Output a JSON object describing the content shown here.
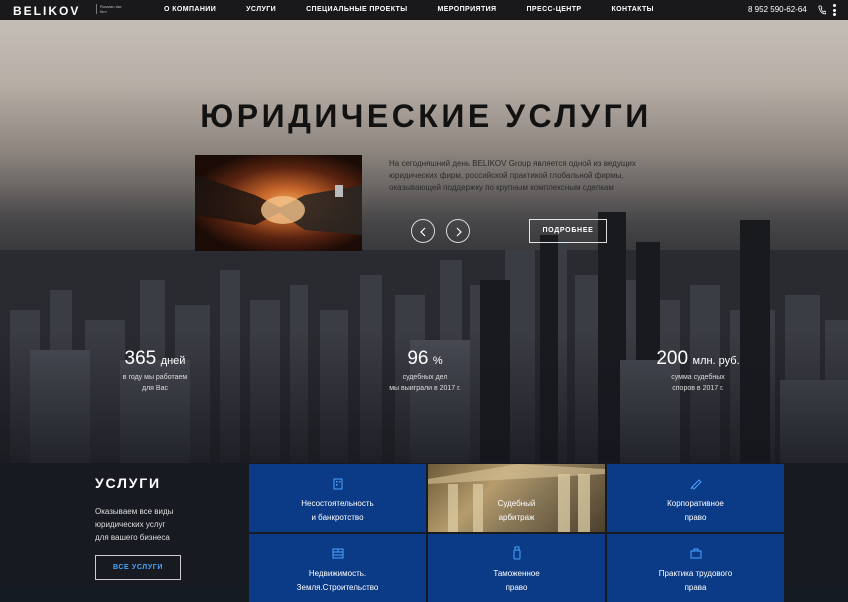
{
  "header": {
    "logo": "BELIKOV",
    "logo_sub": "Russian law firm",
    "nav": [
      "О КОМПАНИИ",
      "УСЛУГИ",
      "СПЕЦИАЛЬНЫЕ ПРОЕКТЫ",
      "МЕРОПРИЯТИЯ",
      "ПРЕСС-ЦЕНТР",
      "КОНТАКТЫ"
    ],
    "phone": "8 952 590-62-64"
  },
  "hero": {
    "title": "ЮРИДИЧЕСКИЕ УСЛУГИ",
    "text": "На сегодняшний день BELIKOV Group является одной из ведущих юридических фирм, российской практикой глобальной фирмы, оказывающей поддержку по крупным комплексным сделкам",
    "more_label": "ПОДРОБНЕЕ"
  },
  "stats": [
    {
      "value": "365",
      "unit": "дней",
      "caption_1": "в году мы работаем",
      "caption_2": "для Вас"
    },
    {
      "value": "96",
      "unit": "%",
      "caption_1": "судебных дел",
      "caption_2": "мы выиграли в 2017 г."
    },
    {
      "value": "200",
      "unit": "млн. руб.",
      "caption_1": "сумма судебных",
      "caption_2": "споров в 2017 г."
    }
  ],
  "services": {
    "title": "УСЛУГИ",
    "desc_1": "Оказываем все виды",
    "desc_2": "юридических услуг",
    "desc_3": "для вашего бизнеса",
    "button": "ВСЕ УСЛУГИ",
    "tiles": [
      {
        "l1": "Несостоятельность",
        "l2": "и банкротство"
      },
      {
        "l1": "Судебный",
        "l2": "арбитраж"
      },
      {
        "l1": "Корпоративное",
        "l2": "право"
      },
      {
        "l1": "Недвижимость.",
        "l2": "Земля.Строительство"
      },
      {
        "l1": "Таможенное",
        "l2": "право"
      },
      {
        "l1": "Практика трудового",
        "l2": "права"
      }
    ]
  },
  "colors": {
    "accent": "#4aa3ff",
    "tile": "#0b3b86"
  }
}
